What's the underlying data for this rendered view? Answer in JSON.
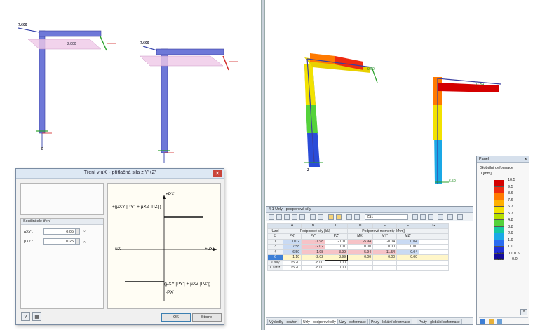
{
  "left_view": {
    "load1_label": "7.600",
    "load2_label": "7.600",
    "member_label": "2.000",
    "axis_z": "Z"
  },
  "right_view": {
    "val_a": "9.50",
    "val_b": "11.54",
    "val_c": "6.50",
    "axis_z": "Z"
  },
  "friction_dialog": {
    "title": "Tření v uX' - přítlačná síla z Y'+Z'",
    "close": "✕",
    "group_header": "Součinitele tření",
    "mu_y_label": "μXY :",
    "mu_y_value": "0.05",
    "mu_z_label": "μXZ :",
    "mu_z_value": "0.25",
    "unit": "[-]",
    "diagram": {
      "top": "+PX'",
      "bottom": "-PX'",
      "pos_formula": "+(μXY |PY'| + μXZ |PZ'|)",
      "neg_formula": "-(μXY |PY'| + μXZ |PZ'|)",
      "left": "-uX'",
      "right": "+uX'"
    },
    "ok": "OK",
    "cancel": "Storno"
  },
  "results_window": {
    "title": "4.1 Uzly - podporové síly",
    "combo": "ZS1",
    "col_letters": [
      "A",
      "B",
      "C",
      "D",
      "E",
      "F",
      "G"
    ],
    "h1": {
      "node": "Uzel",
      "forces": "Podporové síly [kN]",
      "moments": "Podporové momenty [kNm]"
    },
    "h2": [
      "č.",
      "PX'",
      "PY'",
      "PZ'",
      "MX'",
      "MY'",
      "MZ'"
    ],
    "rows": [
      {
        "node": "1",
        "vals": [
          "0.02",
          "-1.98",
          "-0.01",
          "-5.94",
          "-0.04",
          "0.04"
        ]
      },
      {
        "node": "3",
        "vals": [
          "7.58",
          "-2.02",
          "0.01",
          "0.00",
          "0.00",
          "0.00"
        ]
      },
      {
        "node": "4",
        "vals": [
          "6.50",
          "-1.98",
          "-3.99",
          "-5.94",
          "-11.54",
          "0.04"
        ]
      },
      {
        "node": "6",
        "vals": [
          "1.10",
          "-2.02",
          "3.99",
          "0.00",
          "0.00",
          "0.00"
        ]
      },
      {
        "node": "Σ síly",
        "vals": [
          "15.20",
          "-8.00",
          "0.00",
          "",
          "",
          ""
        ]
      },
      {
        "node": "Σ zatíž.",
        "vals": [
          "15.20",
          "-8.00",
          "0.00",
          "",
          "",
          ""
        ]
      }
    ],
    "tabs": [
      "Výsledky - souhrn",
      "Uzly - podporové síly",
      "Uzly - deformace",
      "Pruty - lokální deformace",
      "Pruty - globální deformace"
    ]
  },
  "color_panel": {
    "title": "Panel",
    "close": "✕",
    "heading": "Globální deformace",
    "unit": "u [mm]",
    "scale_values": [
      "10.5",
      "9.5",
      "8.6",
      "7.6",
      "6.7",
      "5.7",
      "4.8",
      "3.8",
      "2.9",
      "1.9",
      "1.0",
      "0.0"
    ],
    "scale_colors": [
      "#d40000",
      "#ee2a10",
      "#ff7a00",
      "#ffb000",
      "#f2e200",
      "#b5e000",
      "#54d23a",
      "#14c8a0",
      "#1aa8e6",
      "#2a6cf0",
      "#1f2fd6",
      "#120a9e"
    ],
    "max_label": "Max",
    "max_value": "10.5",
    "min_label": "Min",
    "min_value": "0.0"
  }
}
